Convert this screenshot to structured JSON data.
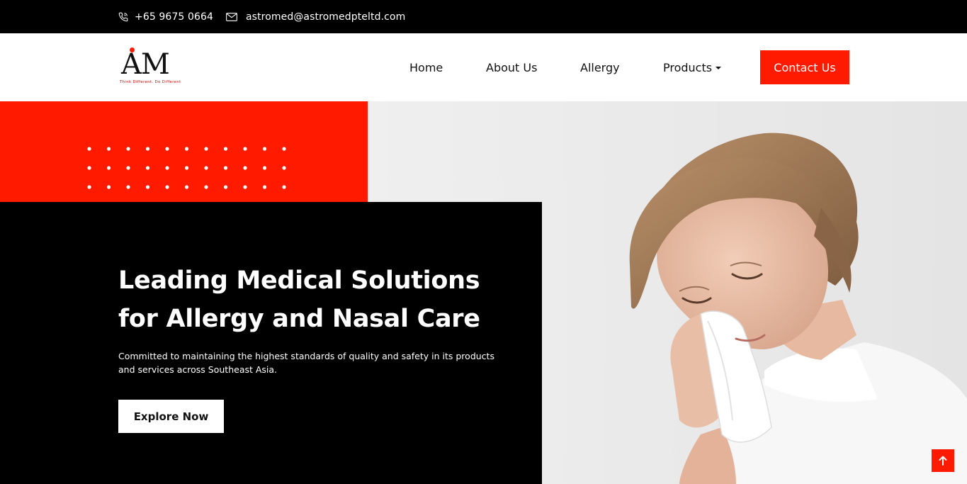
{
  "topbar": {
    "phone": "+65 9675 0664",
    "email": "astromed@astromedpteltd.com",
    "phone_icon": "phone-icon",
    "email_icon": "envelope-icon"
  },
  "logo": {
    "letters": "AM",
    "tagline": "Think Different. Do Different"
  },
  "nav": {
    "items": [
      {
        "label": "Home"
      },
      {
        "label": "About Us"
      },
      {
        "label": "Allergy"
      },
      {
        "label": "Products",
        "has_dropdown": true
      }
    ],
    "cta_label": "Contact Us"
  },
  "hero": {
    "title_lines": [
      "Leading Medical Solutions",
      "for Allergy and Nasal Care"
    ],
    "subtitle_lines": [
      "Committed to maintaining the highest standards of quality and safety in its products",
      "and services across Southeast Asia."
    ],
    "button_label": "Explore Now",
    "image_icon": "woman-sneezing-photo"
  },
  "scroll_top_icon": "arrow-up-icon",
  "colors": {
    "accent": "#ff1a00",
    "dark": "#000000",
    "light": "#ffffff",
    "photo_background": "#ebebeb"
  }
}
